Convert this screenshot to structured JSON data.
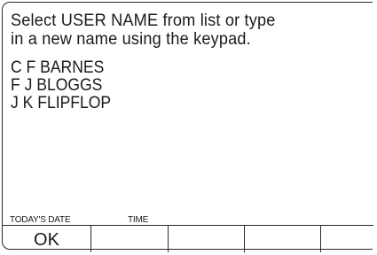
{
  "prompt": {
    "line1": "Select USER NAME from list or type",
    "line2": "in a new name using the keypad."
  },
  "users": [
    "C F BARNES",
    "F J BLOGGS",
    "J K FLIPFLOP"
  ],
  "status": {
    "date_label": "TODAY'S DATE",
    "time_label": "TIME"
  },
  "softkeys": [
    "OK",
    "",
    "",
    "",
    ""
  ]
}
